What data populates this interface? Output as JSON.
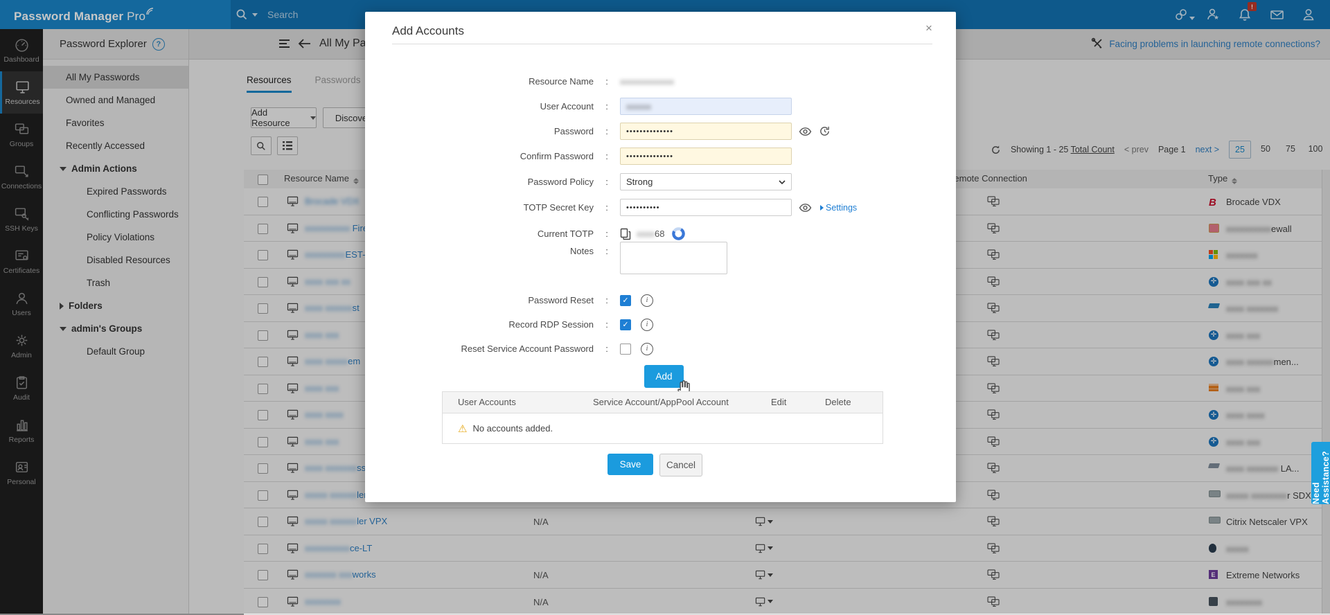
{
  "app": {
    "title": "Password Manager Pro",
    "title_main": "Password Manager",
    "title_pro": "Pro"
  },
  "topbar": {
    "search_placeholder": "Search",
    "icons": [
      "link-icon",
      "user-star-icon",
      "bell-icon",
      "mail-icon",
      "user-icon"
    ],
    "bell_badge": "!"
  },
  "nav": {
    "items": [
      {
        "label": "Dashboard",
        "icon": "dashboard-icon",
        "active": false
      },
      {
        "label": "Resources",
        "icon": "resources-icon",
        "active": true
      },
      {
        "label": "Groups",
        "icon": "groups-icon",
        "active": false
      },
      {
        "label": "Connections",
        "icon": "connections-icon",
        "active": false
      },
      {
        "label": "SSH Keys",
        "icon": "ssh-keys-icon",
        "active": false
      },
      {
        "label": "Certificates",
        "icon": "certificates-icon",
        "active": false
      },
      {
        "label": "Users",
        "icon": "users-icon",
        "active": false
      },
      {
        "label": "Admin",
        "icon": "admin-icon",
        "active": false
      },
      {
        "label": "Audit",
        "icon": "audit-icon",
        "active": false
      },
      {
        "label": "Reports",
        "icon": "reports-icon",
        "active": false
      },
      {
        "label": "Personal",
        "icon": "personal-icon",
        "active": false
      }
    ]
  },
  "explorer": {
    "title": "Password Explorer",
    "items": [
      {
        "label": "All My Passwords",
        "type": "item",
        "selected": true
      },
      {
        "label": "Owned and Managed",
        "type": "item"
      },
      {
        "label": "Favorites",
        "type": "item"
      },
      {
        "label": "Recently Accessed",
        "type": "item"
      },
      {
        "label": "Admin Actions",
        "type": "group",
        "expanded": true
      },
      {
        "label": "Expired Passwords",
        "type": "child"
      },
      {
        "label": "Conflicting Passwords",
        "type": "child"
      },
      {
        "label": "Policy Violations",
        "type": "child"
      },
      {
        "label": "Disabled Resources",
        "type": "child"
      },
      {
        "label": "Trash",
        "type": "child"
      },
      {
        "label": "Folders",
        "type": "group",
        "expanded": false
      },
      {
        "label": "admin's Groups",
        "type": "group",
        "expanded": true
      },
      {
        "label": "Default Group",
        "type": "child"
      }
    ]
  },
  "main": {
    "title": "All My Passwords",
    "remote_help_link": "Facing problems in launching remote connections?",
    "tabs": [
      {
        "label": "Resources",
        "active": true
      },
      {
        "label": "Passwords",
        "active": false
      }
    ],
    "add_resource_label": "Add Resource",
    "discover_label": "Discover Resources",
    "pagination": {
      "showing": "Showing 1 - 25",
      "total_count": "Total Count",
      "prev": "prev",
      "page": "Page 1",
      "next": "next",
      "sizes": [
        "25",
        "50",
        "75",
        "100"
      ],
      "active_size": "25"
    },
    "table": {
      "headers": {
        "resource_name": "Resource Name",
        "remote_connection": "Remote Connection",
        "type": "Type"
      },
      "rows": [
        {
          "name_blur": "Brocade VDX",
          "name_tail": "",
          "na": "",
          "launch": false,
          "type_icon": "brocade",
          "type_blur": "",
          "type_name": "Brocade VDX"
        },
        {
          "name_blur": "xxxxxxxxxx",
          "name_tail": " Fire",
          "na": "",
          "launch": false,
          "type_icon": "checkpoint",
          "type_blur": "xxxxxxxxxx",
          "type_name": "ewall"
        },
        {
          "name_blur": "xxxxxxxxx",
          "name_tail": "EST-",
          "na": "",
          "launch": false,
          "type_icon": "windows",
          "type_blur": "xxxxxxx",
          "type_name": ""
        },
        {
          "name_blur": "xxxx xxx xx",
          "name_tail": "",
          "na": "",
          "launch": false,
          "type_icon": "cisco",
          "type_blur": "xxxx xxx xx",
          "type_name": ""
        },
        {
          "name_blur": "xxxx xxxxxx",
          "name_tail": "st",
          "na": "",
          "launch": false,
          "type_icon": "catalyst",
          "type_blur": "xxxx xxxxxxx",
          "type_name": ""
        },
        {
          "name_blur": "xxxx xxx",
          "name_tail": "",
          "na": "",
          "launch": false,
          "type_icon": "cisco",
          "type_blur": "xxxx xxx",
          "type_name": ""
        },
        {
          "name_blur": "xxxx xxxxx",
          "name_tail": "em",
          "na": "",
          "launch": false,
          "type_icon": "cisco",
          "type_blur": "xxxx xxxxxx",
          "type_name": "men..."
        },
        {
          "name_blur": "xxxx xxx",
          "name_tail": "",
          "na": "",
          "launch": false,
          "type_icon": "pix",
          "type_blur": "xxxx xxx",
          "type_name": ""
        },
        {
          "name_blur": "xxxx xxxx",
          "name_tail": "",
          "na": "",
          "launch": false,
          "type_icon": "cisco",
          "type_blur": "xxxx xxxx",
          "type_name": ""
        },
        {
          "name_blur": "xxxx xxx",
          "name_tail": "",
          "na": "",
          "launch": false,
          "type_icon": "cisco",
          "type_blur": "xxxx xxx",
          "type_name": ""
        },
        {
          "name_blur": "xxxx xxxxxxx",
          "name_tail": "ss L",
          "na": "",
          "launch": false,
          "type_icon": "wireless",
          "type_blur": "xxxx xxxxxxx ",
          "type_name": "LA..."
        },
        {
          "name_blur": "xxxxx xxxxxx",
          "name_tail": "ler",
          "na": "",
          "launch": false,
          "type_icon": "citrix",
          "type_blur": "xxxxx xxxxxxxx",
          "type_name": "r SDX"
        },
        {
          "name_blur": "xxxxx xxxxxx",
          "name_tail": "ler VPX",
          "na": "N/A",
          "launch": true,
          "type_icon": "citrix",
          "type_blur": "",
          "type_name": "Citrix Netscaler VPX"
        },
        {
          "name_blur": "xxxxxxxxxx",
          "name_tail": "ce-LT",
          "na": "",
          "launch": true,
          "type_icon": "linux",
          "type_blur": "xxxxx",
          "type_name": ""
        },
        {
          "name_blur": "xxxxxxx xxx",
          "name_tail": "works",
          "na": "N/A",
          "launch": true,
          "type_icon": "extreme",
          "type_blur": "",
          "type_name": "Extreme Networks"
        },
        {
          "name_blur": "xxxxxxxx",
          "name_tail": "",
          "na": "N/A",
          "launch": true,
          "type_icon": "dark",
          "type_blur": "xxxxxxxx",
          "type_name": ""
        }
      ]
    }
  },
  "modal": {
    "title": "Add Accounts",
    "close_label": "×",
    "fields": {
      "resource_name": {
        "label": "Resource Name",
        "redacted": "xxxxxxxxxxxxx"
      },
      "user_account": {
        "label": "User Account",
        "redacted": "xxxxxx"
      },
      "password": {
        "label": "Password",
        "masked": "••••••••••••••"
      },
      "confirm_password": {
        "label": "Confirm Password",
        "masked": "••••••••••••••"
      },
      "password_policy": {
        "label": "Password Policy",
        "value": "Strong"
      },
      "totp_secret": {
        "label": "TOTP Secret Key",
        "masked": "••••••••••"
      },
      "current_totp": {
        "label": "Current TOTP",
        "redacted": "xxxx",
        "visible_digits": "68"
      },
      "notes": {
        "label": "Notes",
        "value": ""
      }
    },
    "settings_label": "Settings",
    "checkboxes": {
      "password_reset": {
        "label": "Password Reset",
        "checked": true
      },
      "record_rdp": {
        "label": "Record RDP Session",
        "checked": true
      },
      "reset_service": {
        "label": "Reset Service Account Password",
        "checked": false
      }
    },
    "add_label": "Add",
    "accounts_table": {
      "headers": [
        "User Accounts",
        "Service Account/AppPool Account",
        "Edit",
        "Delete"
      ],
      "empty_message": "No accounts added."
    },
    "save_label": "Save",
    "cancel_label": "Cancel"
  },
  "assistance_label": "Need Assistance?"
}
